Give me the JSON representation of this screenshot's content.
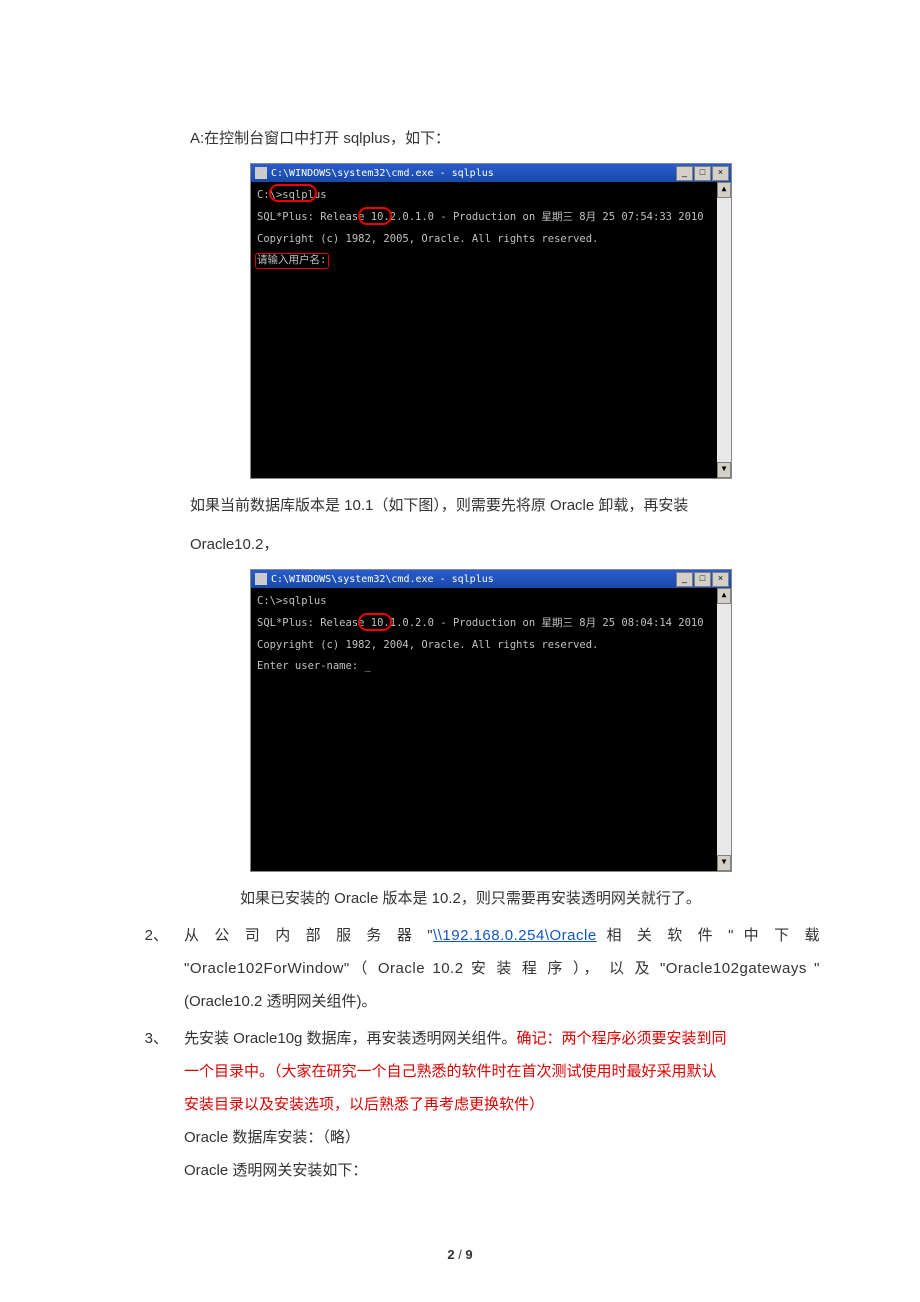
{
  "intro": {
    "line_a": "A:在控制台窗口中打开 sqlplus，如下："
  },
  "shot1": {
    "title": "C:\\WINDOWS\\system32\\cmd.exe - sqlplus",
    "lines": {
      "l0": "C:\\>sqlplus",
      "l1": "SQL*Plus: Release 10.2.0.1.0 - Production on 星期三 8月 25 07:54:33 2010",
      "l2": "Copyright (c) 1982, 2005, Oracle.  All rights reserved.",
      "l3": "请输入用户名:"
    },
    "btn_min": "_",
    "btn_max": "□",
    "btn_close": "×",
    "scroll_up": "▲",
    "scroll_dn": "▼"
  },
  "mid1": "如果当前数据库版本是 10.1（如下图），则需要先将原 Oracle 卸载，再安装",
  "mid2": "Oracle10.2，",
  "shot2": {
    "title": "C:\\WINDOWS\\system32\\cmd.exe - sqlplus",
    "lines": {
      "l0": "C:\\>sqlplus",
      "l1": "SQL*Plus: Release 10.1.0.2.0 - Production on 星期三 8月 25 08:04:14 2010",
      "l2": "Copyright (c) 1982, 2004, Oracle.  All rights reserved.",
      "l3": "Enter user-name: _"
    }
  },
  "after2": "如果已安装的 Oracle 版本是 10.2，则只需要再安装透明网关就行了。",
  "item2": {
    "num": "2、",
    "l1a": "从 公 司 内 部 服 务 器  \"",
    "l1link": "\\\\192.168.0.254\\Oracle",
    "l1b": " 相 关 软 件 \" 中 下 载",
    "l2": "\"Oracle102ForWindow\"（ Oracle 10.2 安 装 程 序 ）， 以 及 \"Oracle102gateways \"",
    "l3": "(Oracle10.2 透明网关组件)。"
  },
  "item3": {
    "num": "3、",
    "l1a": "先安装 Oracle10g 数据库，再安装透明网关组件。",
    "l1r": "确记：两个程序必须要安装到同",
    "l2r": "一个目录中。（大家在研究一个自己熟悉的软件时在首次测试使用时最好采用默认",
    "l3r": "安装目录以及安装选项，以后熟悉了再考虑更换软件）",
    "l4": "Oracle 数据库安装：（略）",
    "l5": "Oracle 透明网关安装如下："
  },
  "page": {
    "cur": "2",
    "sep": " / ",
    "tot": "9"
  }
}
